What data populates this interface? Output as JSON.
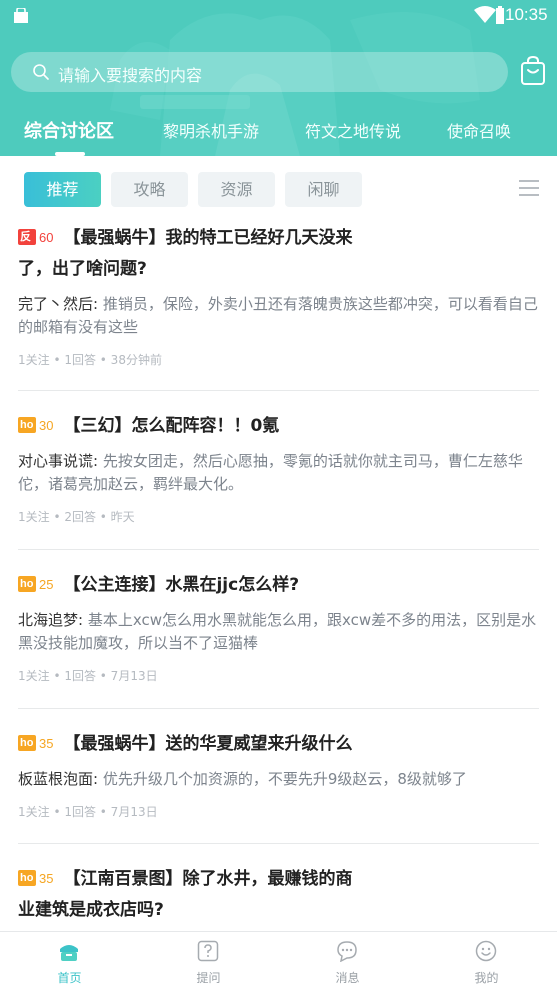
{
  "status_bar": {
    "time": "10:35"
  },
  "search": {
    "placeholder": "请输入要搜索的内容"
  },
  "top_nav": {
    "items": [
      {
        "label": "综合讨论区"
      },
      {
        "label": "黎明杀机手游"
      },
      {
        "label": "符文之地传说"
      },
      {
        "label": "使命召唤"
      }
    ]
  },
  "filters": {
    "items": [
      {
        "label": "推荐"
      },
      {
        "label": "攻略"
      },
      {
        "label": "资源"
      },
      {
        "label": "闲聊"
      }
    ]
  },
  "posts": [
    {
      "badge": "red",
      "score": "60",
      "title_line1": "【最强蜗牛】我的特工已经好几天没来",
      "title_line2": "了，出了啥问题?",
      "author": "完了丶然后:",
      "answer": "推销员，保险，外卖小丑还有落魄贵族这些都冲突，可以看看自己的邮箱有没有这些",
      "meta": "1关注 • 1回答 • 38分钟前"
    },
    {
      "badge": "orange",
      "score": "30",
      "title_line1": "【三幻】怎么配阵容！！0氪",
      "title_line2": "",
      "author": "对心事说谎:",
      "answer": "先按女团走，然后心愿抽，零氪的话就你就主司马，曹仁左慈华佗，诸葛亮加赵云，羁绊最大化。",
      "meta": "1关注 • 2回答 • 昨天"
    },
    {
      "badge": "orange",
      "score": "25",
      "title_line1": "【公主连接】水黑在jjc怎么样?",
      "title_line2": "",
      "author": "北海追梦:",
      "answer": "基本上xcw怎么用水黑就能怎么用，跟xcw差不多的用法，区别是水黑没技能加魔攻，所以当不了逗猫棒",
      "meta": "1关注 • 1回答 • 7月13日"
    },
    {
      "badge": "orange",
      "score": "35",
      "title_line1": "【最强蜗牛】送的华夏威望来升级什么",
      "title_line2": "",
      "author": "板蓝根泡面:",
      "answer": "优先升级几个加资源的，不要先升9级赵云，8级就够了",
      "meta": "1关注 • 1回答 • 7月13日"
    },
    {
      "badge": "orange",
      "score": "35",
      "title_line1": "【江南百景图】除了水井，最赚钱的商",
      "title_line2": "业建筑是成衣店吗?",
      "author": "",
      "answer": "",
      "meta": ""
    }
  ],
  "tab_bar": {
    "items": [
      {
        "label": "首页",
        "icon": "home-icon"
      },
      {
        "label": "提问",
        "icon": "question-icon"
      },
      {
        "label": "消息",
        "icon": "message-icon"
      },
      {
        "label": "我的",
        "icon": "profile-icon"
      }
    ]
  },
  "colors": {
    "header": "#4ecbbd",
    "accent": "#3cc3c8",
    "badge_red": "#f2423c",
    "badge_orange": "#f7a623"
  }
}
